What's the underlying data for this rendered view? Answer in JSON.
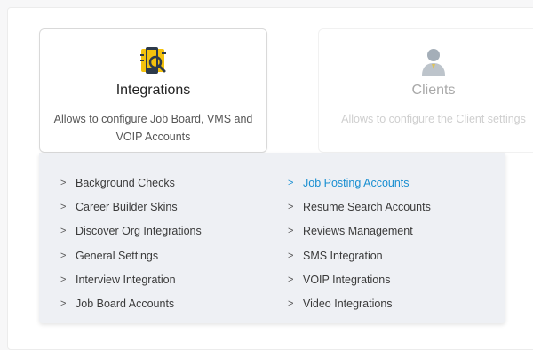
{
  "cards": [
    {
      "title": "Integrations",
      "desc": "Allows to configure Job Board, VMS and VOIP Accounts",
      "icon": "integrations-icon"
    },
    {
      "title": "Clients",
      "desc": "Allows to configure the Client settings",
      "icon": "client-user-icon"
    }
  ],
  "menu": {
    "chevron": ">",
    "left": [
      "Background Checks",
      "Career Builder Skins",
      "Discover Org Integrations",
      "General Settings",
      "Interview Integration",
      "Job Board Accounts"
    ],
    "right": [
      "Job Posting Accounts",
      "Resume Search Accounts",
      "Reviews Management",
      "SMS Integration",
      "VOIP Integrations",
      "Video Integrations"
    ],
    "selected": "Job Posting Accounts"
  },
  "colors": {
    "accent": "#1a8fd1",
    "icon_yellow": "#f4c20d",
    "icon_dark": "#2d3a4a",
    "client_icon": "#5a6b7d"
  }
}
